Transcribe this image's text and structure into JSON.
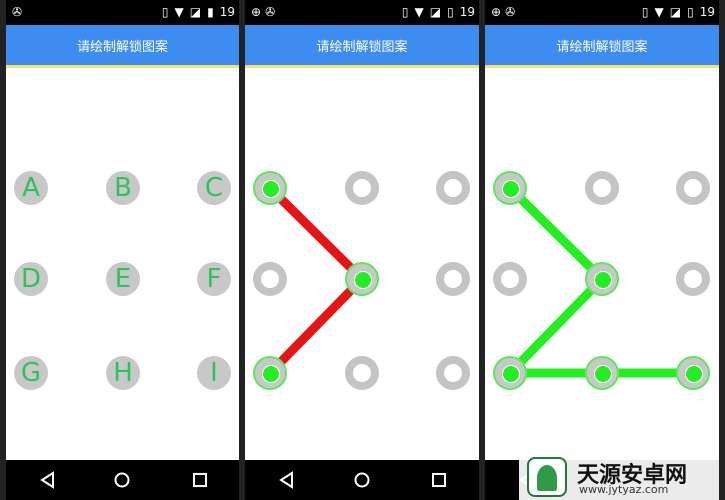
{
  "status_bar": {
    "time": "19"
  },
  "app_title": "请绘制解锁图案",
  "panel1": {
    "letters": [
      "A",
      "B",
      "C",
      "D",
      "E",
      "F",
      "G",
      "H",
      "I"
    ]
  },
  "panel2": {
    "active_nodes": [
      0,
      4,
      6
    ],
    "path": [
      0,
      4,
      6
    ],
    "line_color": "#e51515"
  },
  "panel3": {
    "active_nodes": [
      0,
      4,
      6,
      7,
      8
    ],
    "path": [
      0,
      4,
      6,
      7,
      8
    ],
    "line_color": "#22ee22"
  },
  "colors": {
    "appbar": "#3d8cf0",
    "ring": "#c4c4c4",
    "active_dot": "#22ee22",
    "letter": "#2ec35a"
  },
  "nav_icons": [
    "back-icon",
    "home-icon",
    "recents-icon"
  ],
  "watermark": {
    "title": "天源安卓网",
    "url": "www.jytyaz.com"
  }
}
